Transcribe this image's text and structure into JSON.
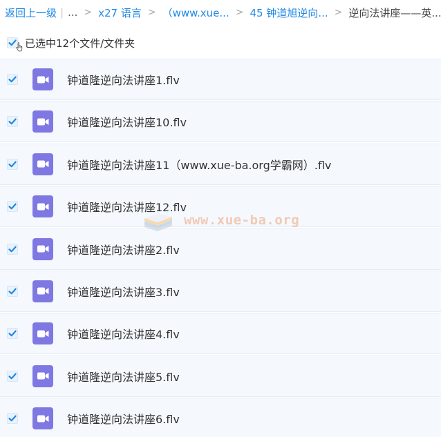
{
  "breadcrumb": {
    "back_label": "返回上一级",
    "ellipsis": "...",
    "separator": ">",
    "items": [
      "x27 语言",
      "（www.xue...",
      "45 钟道旭逆向..."
    ],
    "current": "逆向法讲座——英..."
  },
  "selection": {
    "label": "已选中12个文件/文件夹",
    "checked": true
  },
  "files": [
    {
      "name": "钟道隆逆向法讲座1.flv",
      "checked": true
    },
    {
      "name": "钟道隆逆向法讲座10.flv",
      "checked": true
    },
    {
      "name": "钟道隆逆向法讲座11（www.xue-ba.org学霸网）.flv",
      "checked": true
    },
    {
      "name": "钟道隆逆向法讲座12.flv",
      "checked": true
    },
    {
      "name": "钟道隆逆向法讲座2.flv",
      "checked": true
    },
    {
      "name": "钟道隆逆向法讲座3.flv",
      "checked": true
    },
    {
      "name": "钟道隆逆向法讲座4.flv",
      "checked": true
    },
    {
      "name": "钟道隆逆向法讲座5.flv",
      "checked": true
    },
    {
      "name": "钟道隆逆向法讲座6.flv",
      "checked": true
    }
  ],
  "watermark": {
    "text": "www.xue-ba.org"
  },
  "colors": {
    "link": "#1e88e5",
    "check": "#1e88e5",
    "row_bg": "#f5f9fe",
    "video_icon": "#7f78e3"
  },
  "icons": {
    "checkbox": "checkmark-icon",
    "file": "video-file-icon",
    "cursor": "hand-pointer-icon"
  }
}
